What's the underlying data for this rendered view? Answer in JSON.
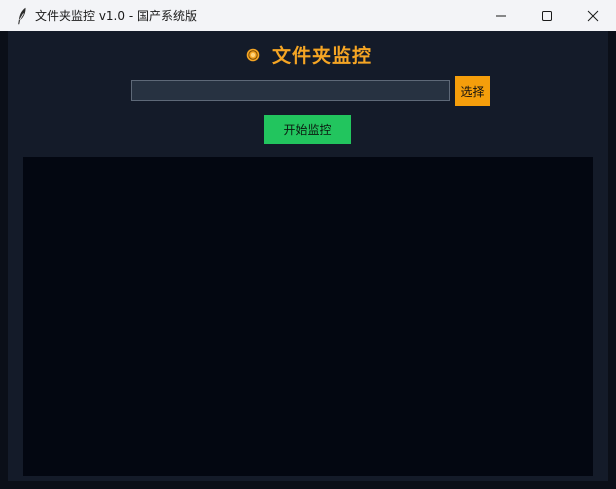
{
  "window": {
    "title": "文件夹监控  v1.0  -  国产系统版"
  },
  "titlebar_icons": {
    "app": "feather-icon",
    "minimize": "minimize-icon",
    "maximize": "maximize-icon",
    "close": "close-icon"
  },
  "header": {
    "title": "文件夹监控",
    "icon": "orange-circle-icon"
  },
  "folder_input": {
    "value": "",
    "placeholder": ""
  },
  "buttons": {
    "select_label": "选择",
    "start_label": "开始监控"
  },
  "log": {
    "content": ""
  },
  "colors": {
    "accent": "#f5a524",
    "select_button": "#f59e0b",
    "start_button": "#22c55e",
    "background": "#141b29",
    "log_background": "#030711"
  }
}
